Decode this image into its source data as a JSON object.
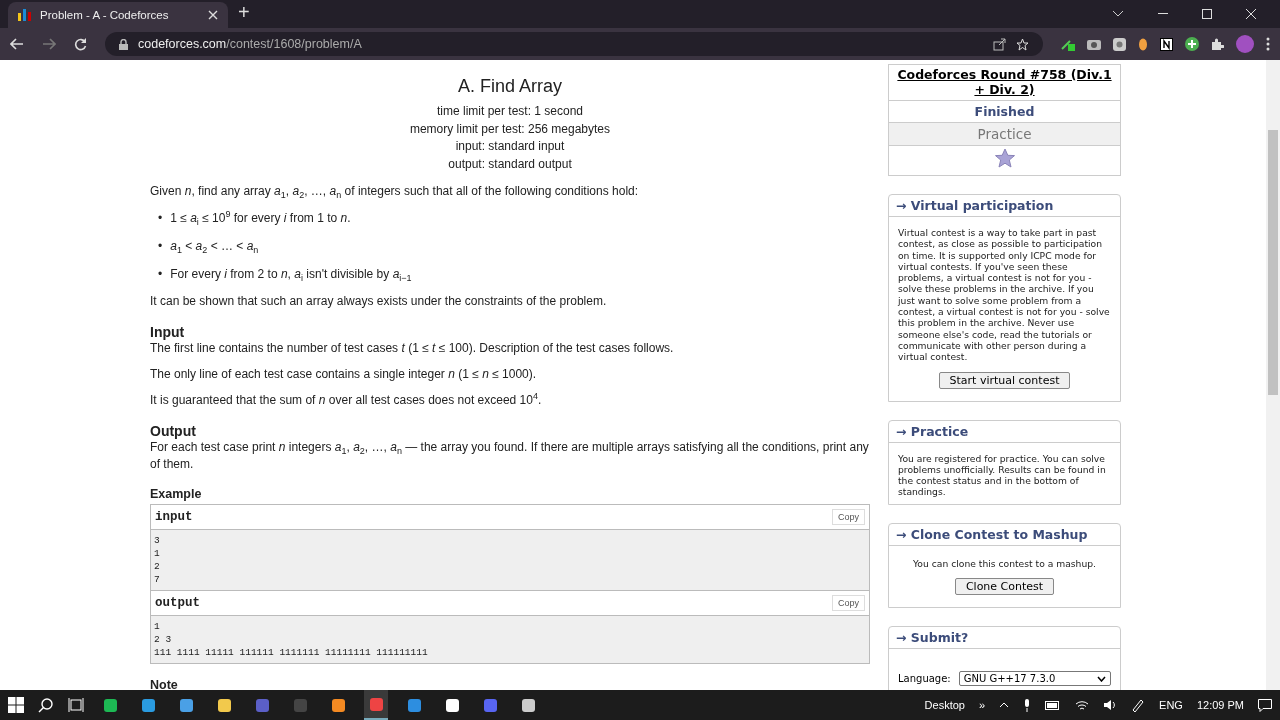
{
  "browser": {
    "tabs": [
      {
        "title": "Problem - A - Codeforces",
        "selected": true
      }
    ],
    "new_tab": "+",
    "url_host": "codeforces.com",
    "url_path": "/contest/1608/problem/A"
  },
  "problem": {
    "title": "A. Find Array",
    "limits": [
      "time limit per test: 1 second",
      "memory limit per test: 256 megabytes",
      "input: standard input",
      "output: standard output"
    ],
    "statement": "Given *n*, find any array *a*$_{1}$, *a*$_{2}$, …, *a*$_{n}$ of integers such that all of the following conditions hold:",
    "conditions": [
      {
        "marker": "•",
        "text": "1 ≤ *a*$_{i}$ ≤ 10$^{9}$ for every *i* from 1 to *n*."
      },
      {
        "marker": "•",
        "text": "*a*$_{1}$ < *a*$_{2}$ < … < *a*$_{n}$"
      },
      {
        "marker": "•",
        "text": "For every *i* from 2 to *n*, *a*$_{i}$ isn't divisible by *a*$_{i−1}$"
      }
    ],
    "closing": "It can be shown that such an array always exists under the constraints of the problem.",
    "sections": [
      {
        "heading": "Input",
        "paragraphs": [
          "The first line contains the number of test cases *t* (1 ≤ *t* ≤ 100). Description of the test cases follows.",
          "The only line of each test case contains a single integer *n* (1 ≤ *n* ≤ 1000).",
          "It is guaranteed that the sum of *n* over all test cases does not exceed 10$^{4}$."
        ]
      },
      {
        "heading": "Output",
        "paragraphs": [
          "For each test case print *n* integers *a*$_{1}$, *a*$_{2}$, …, *a*$_{n}$ — the array you found. If there are multiple arrays satisfying all the conditions, print any of them."
        ]
      }
    ],
    "example_heading": "Example",
    "samples": [
      {
        "title": "input",
        "copy": "Copy",
        "lines": [
          "3",
          "1",
          "2",
          "7"
        ]
      },
      {
        "title": "output",
        "copy": "Copy",
        "lines": [
          "1",
          "2 3",
          "111 1111 11111 111111 1111111 11111111 111111111"
        ]
      }
    ],
    "note_heading": "Note"
  },
  "sidebar": {
    "round": {
      "name": "Codeforces Round #758 (Div.1 + Div. 2)",
      "status": "Finished",
      "mode": "Practice"
    },
    "boxes": [
      {
        "kind": "text",
        "title": "→ Virtual participation",
        "text": "Virtual contest is a way to take part in past contest, as close as possible to participation on time. It is supported only ICPC mode for virtual contests. If you've seen these problems, a virtual contest is not for you - solve these problems in the archive. If you just want to solve some problem from a contest, a virtual contest is not for you - solve this problem in the archive. Never use someone else's code, read the tutorials or communicate with other person during a virtual contest.",
        "button": "Start virtual contest"
      },
      {
        "kind": "text",
        "title": "→ Practice",
        "text": "You are registered for practice. You can solve problems unofficially. Results can be found in the contest status and in the bottom of standings."
      },
      {
        "kind": "centered",
        "title": "→ Clone Contest to Mashup",
        "text": "You can clone this contest to a mashup.",
        "button": "Clone Contest"
      },
      {
        "kind": "form",
        "title": "→ Submit?",
        "label": "Language:",
        "value": "GNU G++17 7.3.0"
      }
    ]
  },
  "taskbar": {
    "apps": [
      {
        "kind": "spotify",
        "selected": false
      },
      {
        "kind": "edge",
        "selected": false
      },
      {
        "kind": "app",
        "selected": false
      },
      {
        "kind": "folder",
        "selected": false
      },
      {
        "kind": "teams",
        "selected": false
      },
      {
        "kind": "terminal",
        "selected": false
      },
      {
        "kind": "sublime",
        "selected": false
      },
      {
        "kind": "chrome",
        "selected": true
      },
      {
        "kind": "vscode",
        "selected": false
      },
      {
        "kind": "notion",
        "selected": false
      },
      {
        "kind": "discord",
        "selected": false
      },
      {
        "kind": "obs",
        "selected": false
      }
    ],
    "desktop": "Desktop",
    "chevron": "»",
    "lang": "ENG",
    "time": "12:09 PM"
  }
}
